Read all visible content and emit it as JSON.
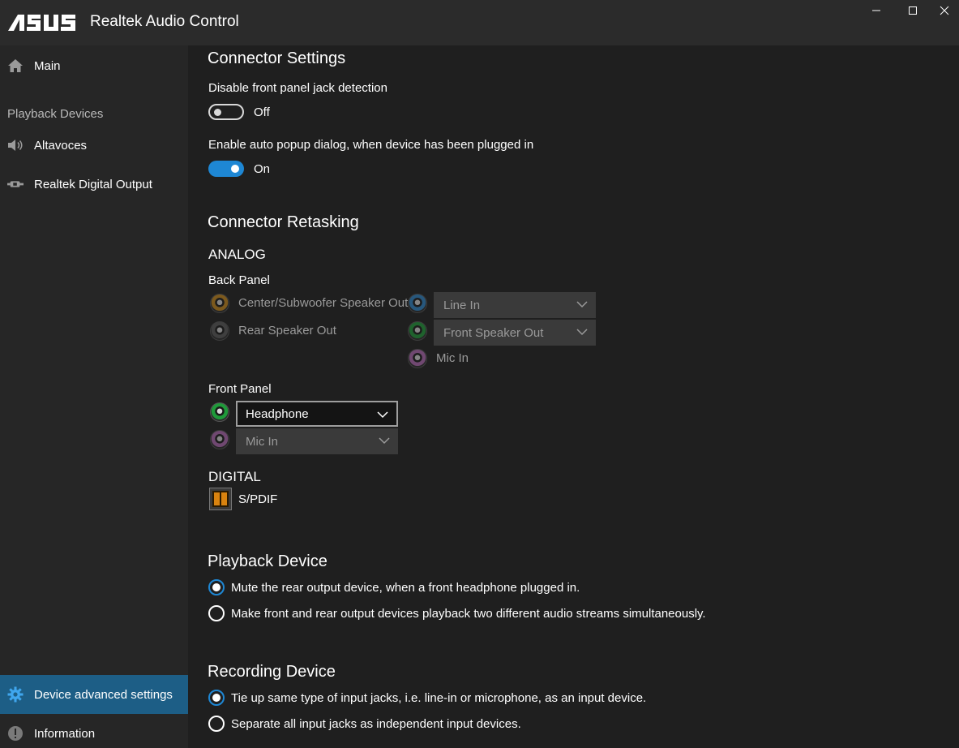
{
  "window": {
    "brand": "ASUS",
    "title": "Realtek Audio Control"
  },
  "sidebar": {
    "main_label": "Main",
    "playback_section": "Playback Devices",
    "devices": [
      "Altavoces",
      "Realtek Digital Output"
    ],
    "advanced_label": "Device advanced settings",
    "information_label": "Information"
  },
  "connector_settings": {
    "title": "Connector Settings",
    "front_jack_label": "Disable front panel jack detection",
    "front_jack_state": "Off",
    "auto_popup_label": "Enable auto popup dialog, when device has been plugged in",
    "auto_popup_state": "On"
  },
  "retasking": {
    "title": "Connector Retasking",
    "analog": "ANALOG",
    "back_panel": "Back Panel",
    "back_left": [
      "Center/Subwoofer Speaker Out",
      "Rear Speaker Out"
    ],
    "back_right_selects": [
      "Line In",
      "Front Speaker Out"
    ],
    "back_right_static": "Mic In",
    "front_panel": "Front Panel",
    "front_selects": [
      "Headphone",
      "Mic In"
    ],
    "digital": "DIGITAL",
    "spdif": "S/PDIF"
  },
  "playback_device": {
    "title": "Playback Device",
    "options": [
      "Mute the rear output device, when a front headphone plugged in.",
      "Make front and rear output devices playback two different audio streams simultaneously."
    ]
  },
  "recording_device": {
    "title": "Recording Device",
    "options": [
      "Tie up same type of input jacks, i.e. line-in or microphone, as an input device.",
      "Separate all input jacks as independent input devices."
    ]
  },
  "colors": {
    "accent": "#1e87d4",
    "active_nav": "#1d5e86",
    "jack_orange": "#c98a1d",
    "jack_blue": "#2f86c9",
    "jack_green": "#1f9a3a",
    "jack_pink": "#b36bb5",
    "jack_black": "#5a5a5a"
  }
}
